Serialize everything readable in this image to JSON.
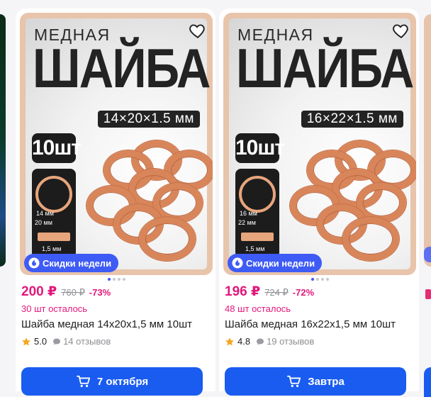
{
  "products": [
    {
      "image": {
        "heading_small": "МЕДНАЯ",
        "heading_big": "ШАЙБА",
        "size_badge": "14×20×1.5 мм",
        "qty_badge": "10шт",
        "inner_diameter": "14 мм",
        "outer_diameter": "20 мм",
        "thickness": "1,5 мм"
      },
      "promo_label": "Скидки недели",
      "price": "200 ₽",
      "old_price": "760 ₽",
      "discount": "-73%",
      "stock": "30 шт осталось",
      "title": "Шайба медная 14х20х1,5 мм 10шт",
      "rating": "5.0",
      "reviews": "14 отзывов",
      "button_label": "7 октября"
    },
    {
      "image": {
        "heading_small": "МЕДНАЯ",
        "heading_big": "ШАЙБА",
        "size_badge": "16×22×1.5 мм",
        "qty_badge": "10шт",
        "inner_diameter": "16 мм",
        "outer_diameter": "22 мм",
        "thickness": "1,5 мм"
      },
      "promo_label": "Скидки недели",
      "price": "196 ₽",
      "old_price": "724 ₽",
      "discount": "-72%",
      "stock": "48 шт осталось",
      "title": "Шайба медная 16х22х1,5 мм 10шт",
      "rating": "4.8",
      "reviews": "19 отзывов",
      "button_label": "Завтра"
    }
  ],
  "icons": {
    "favorite": "heart-icon",
    "promo": "flame-icon",
    "rating": "star-icon",
    "reviews": "chat-bubble-icon",
    "cart": "cart-icon"
  },
  "colors": {
    "accent": "#1a5cf0",
    "promo": "#3e5bf5",
    "price": "#e2187b",
    "star": "#f5a623"
  }
}
